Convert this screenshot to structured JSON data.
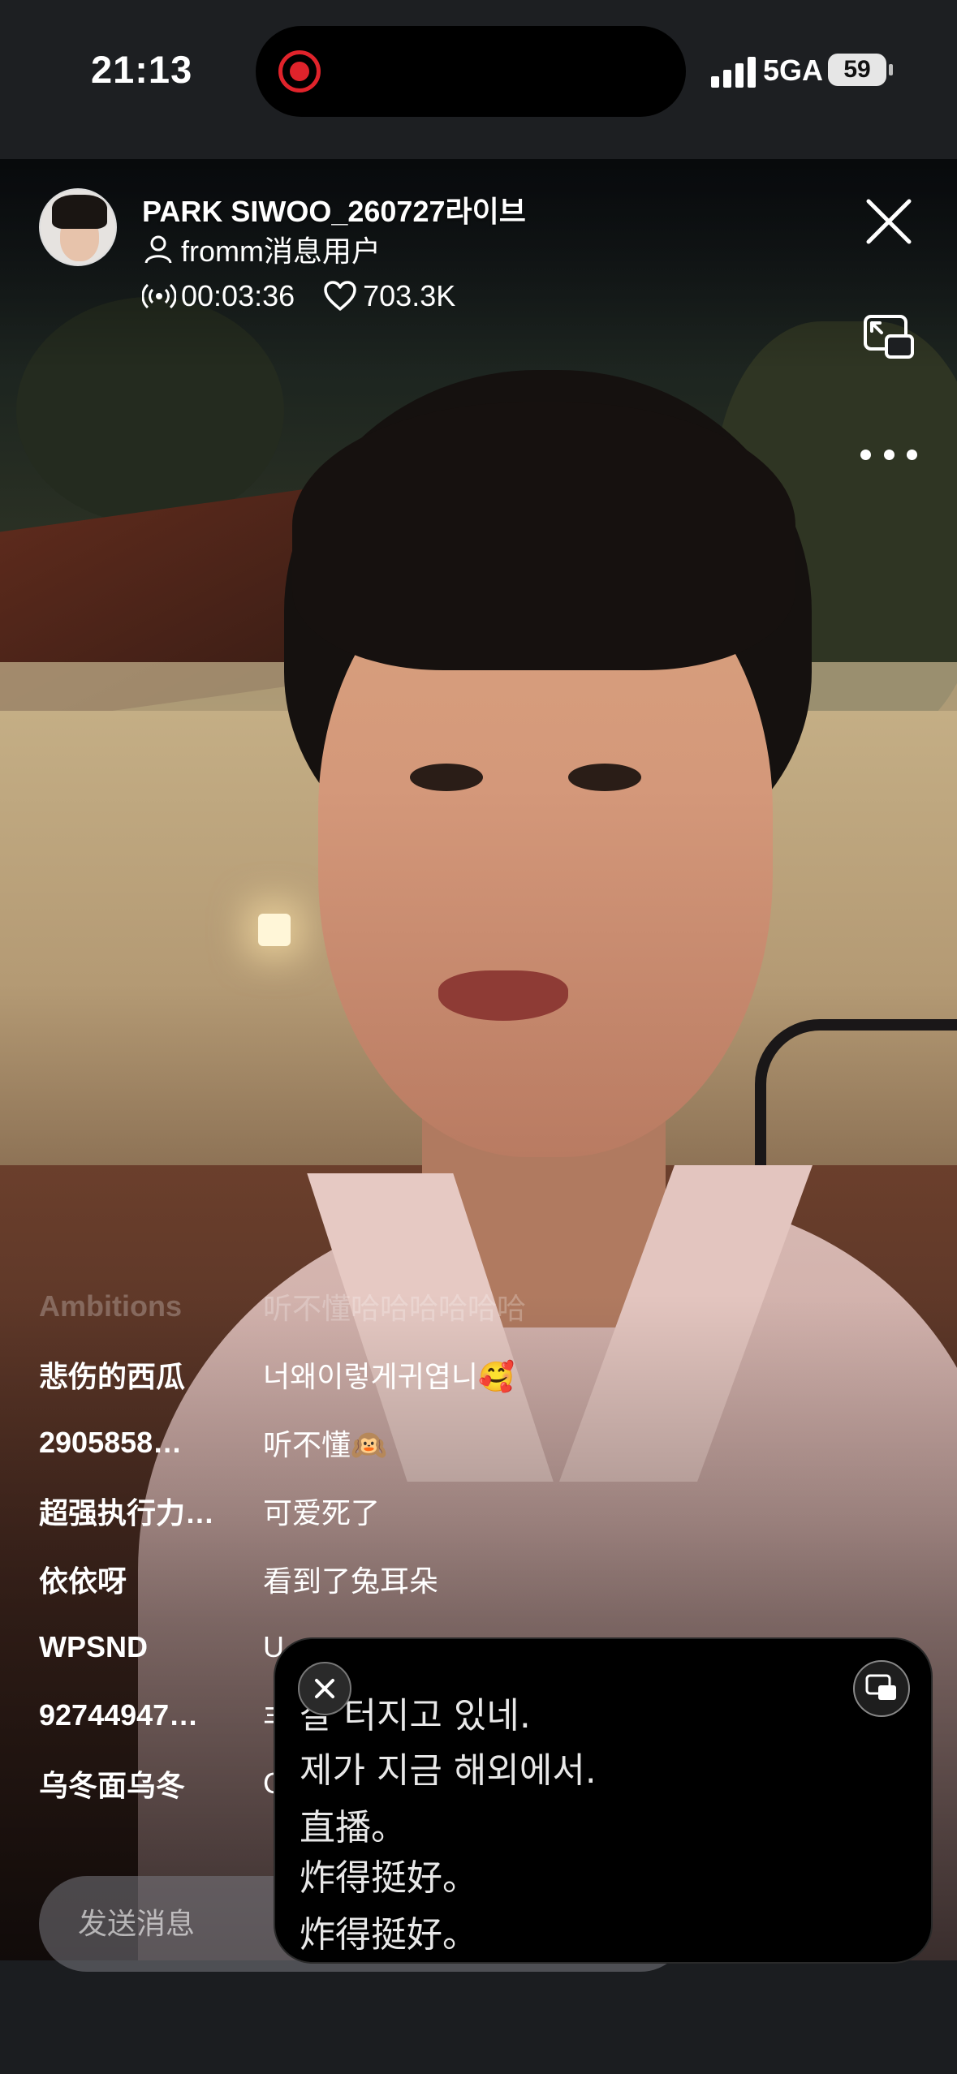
{
  "status_bar": {
    "time": "21:13",
    "network": "5GA",
    "battery": "59"
  },
  "live": {
    "title": "PARK SIWOO_260727라이브",
    "user": "fromm消息用户",
    "duration": "00:03:36",
    "likes": "703.3K"
  },
  "icons": {
    "close": "close-icon",
    "pip": "picture-in-picture-icon",
    "more": "more-icon",
    "broadcast": "broadcast-icon",
    "heart": "heart-icon",
    "person": "person-icon"
  },
  "comments": [
    {
      "name": "Ambitions",
      "text": "听不懂哈哈哈哈哈哈"
    },
    {
      "name": "悲伤的西瓜",
      "text": "너왜이렇게귀엽니🥰"
    },
    {
      "name": "2905858…",
      "text": "听不懂🙉"
    },
    {
      "name": "超强执行力…",
      "text": "可爱死了"
    },
    {
      "name": "依依呀",
      "text": "看到了兔耳朵"
    },
    {
      "name": "WPSND",
      "text": "U"
    },
    {
      "name": "92744947…",
      "text": "丰"
    },
    {
      "name": "乌冬面乌冬",
      "text": "C"
    }
  ],
  "input": {
    "placeholder": "发送消息"
  },
  "captions": {
    "lines": [
      "잘 터지고 있네.",
      "제가 지금 해외에서.",
      "直播。",
      "炸得挺好。",
      "炸得挺好。"
    ]
  },
  "colors": {
    "record": "#e0232b",
    "background": "#1b1d20"
  }
}
